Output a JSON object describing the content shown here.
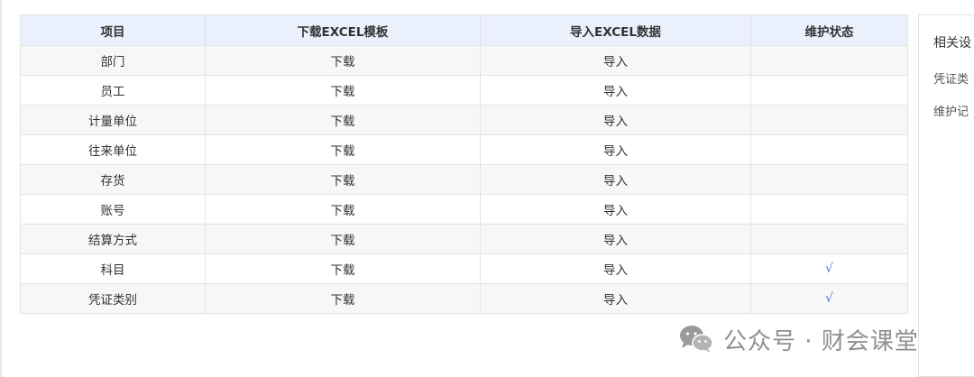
{
  "table": {
    "headers": {
      "item": "项目",
      "download": "下载EXCEL模板",
      "import": "导入EXCEL数据",
      "status": "维护状态"
    },
    "rows": [
      {
        "item": "部门",
        "download": "下载",
        "import": "导入",
        "status": ""
      },
      {
        "item": "员工",
        "download": "下载",
        "import": "导入",
        "status": ""
      },
      {
        "item": "计量单位",
        "download": "下载",
        "import": "导入",
        "status": ""
      },
      {
        "item": "往来单位",
        "download": "下载",
        "import": "导入",
        "status": ""
      },
      {
        "item": "存货",
        "download": "下载",
        "import": "导入",
        "status": ""
      },
      {
        "item": "账号",
        "download": "下载",
        "import": "导入",
        "status": ""
      },
      {
        "item": "结算方式",
        "download": "下载",
        "import": "导入",
        "status": ""
      },
      {
        "item": "科目",
        "download": "下载",
        "import": "导入",
        "status": "√"
      },
      {
        "item": "凭证类别",
        "download": "下载",
        "import": "导入",
        "status": "√"
      }
    ]
  },
  "side_panel": {
    "title": "相关设",
    "line1": "凭证类",
    "line2": "维护记"
  },
  "watermark": {
    "icon": "wechat-icon",
    "text": "公众号 · 财会课堂"
  },
  "colors": {
    "header_bg": "#eaf1fc",
    "check": "#4a7fd6",
    "border": "#dfe3ea"
  }
}
